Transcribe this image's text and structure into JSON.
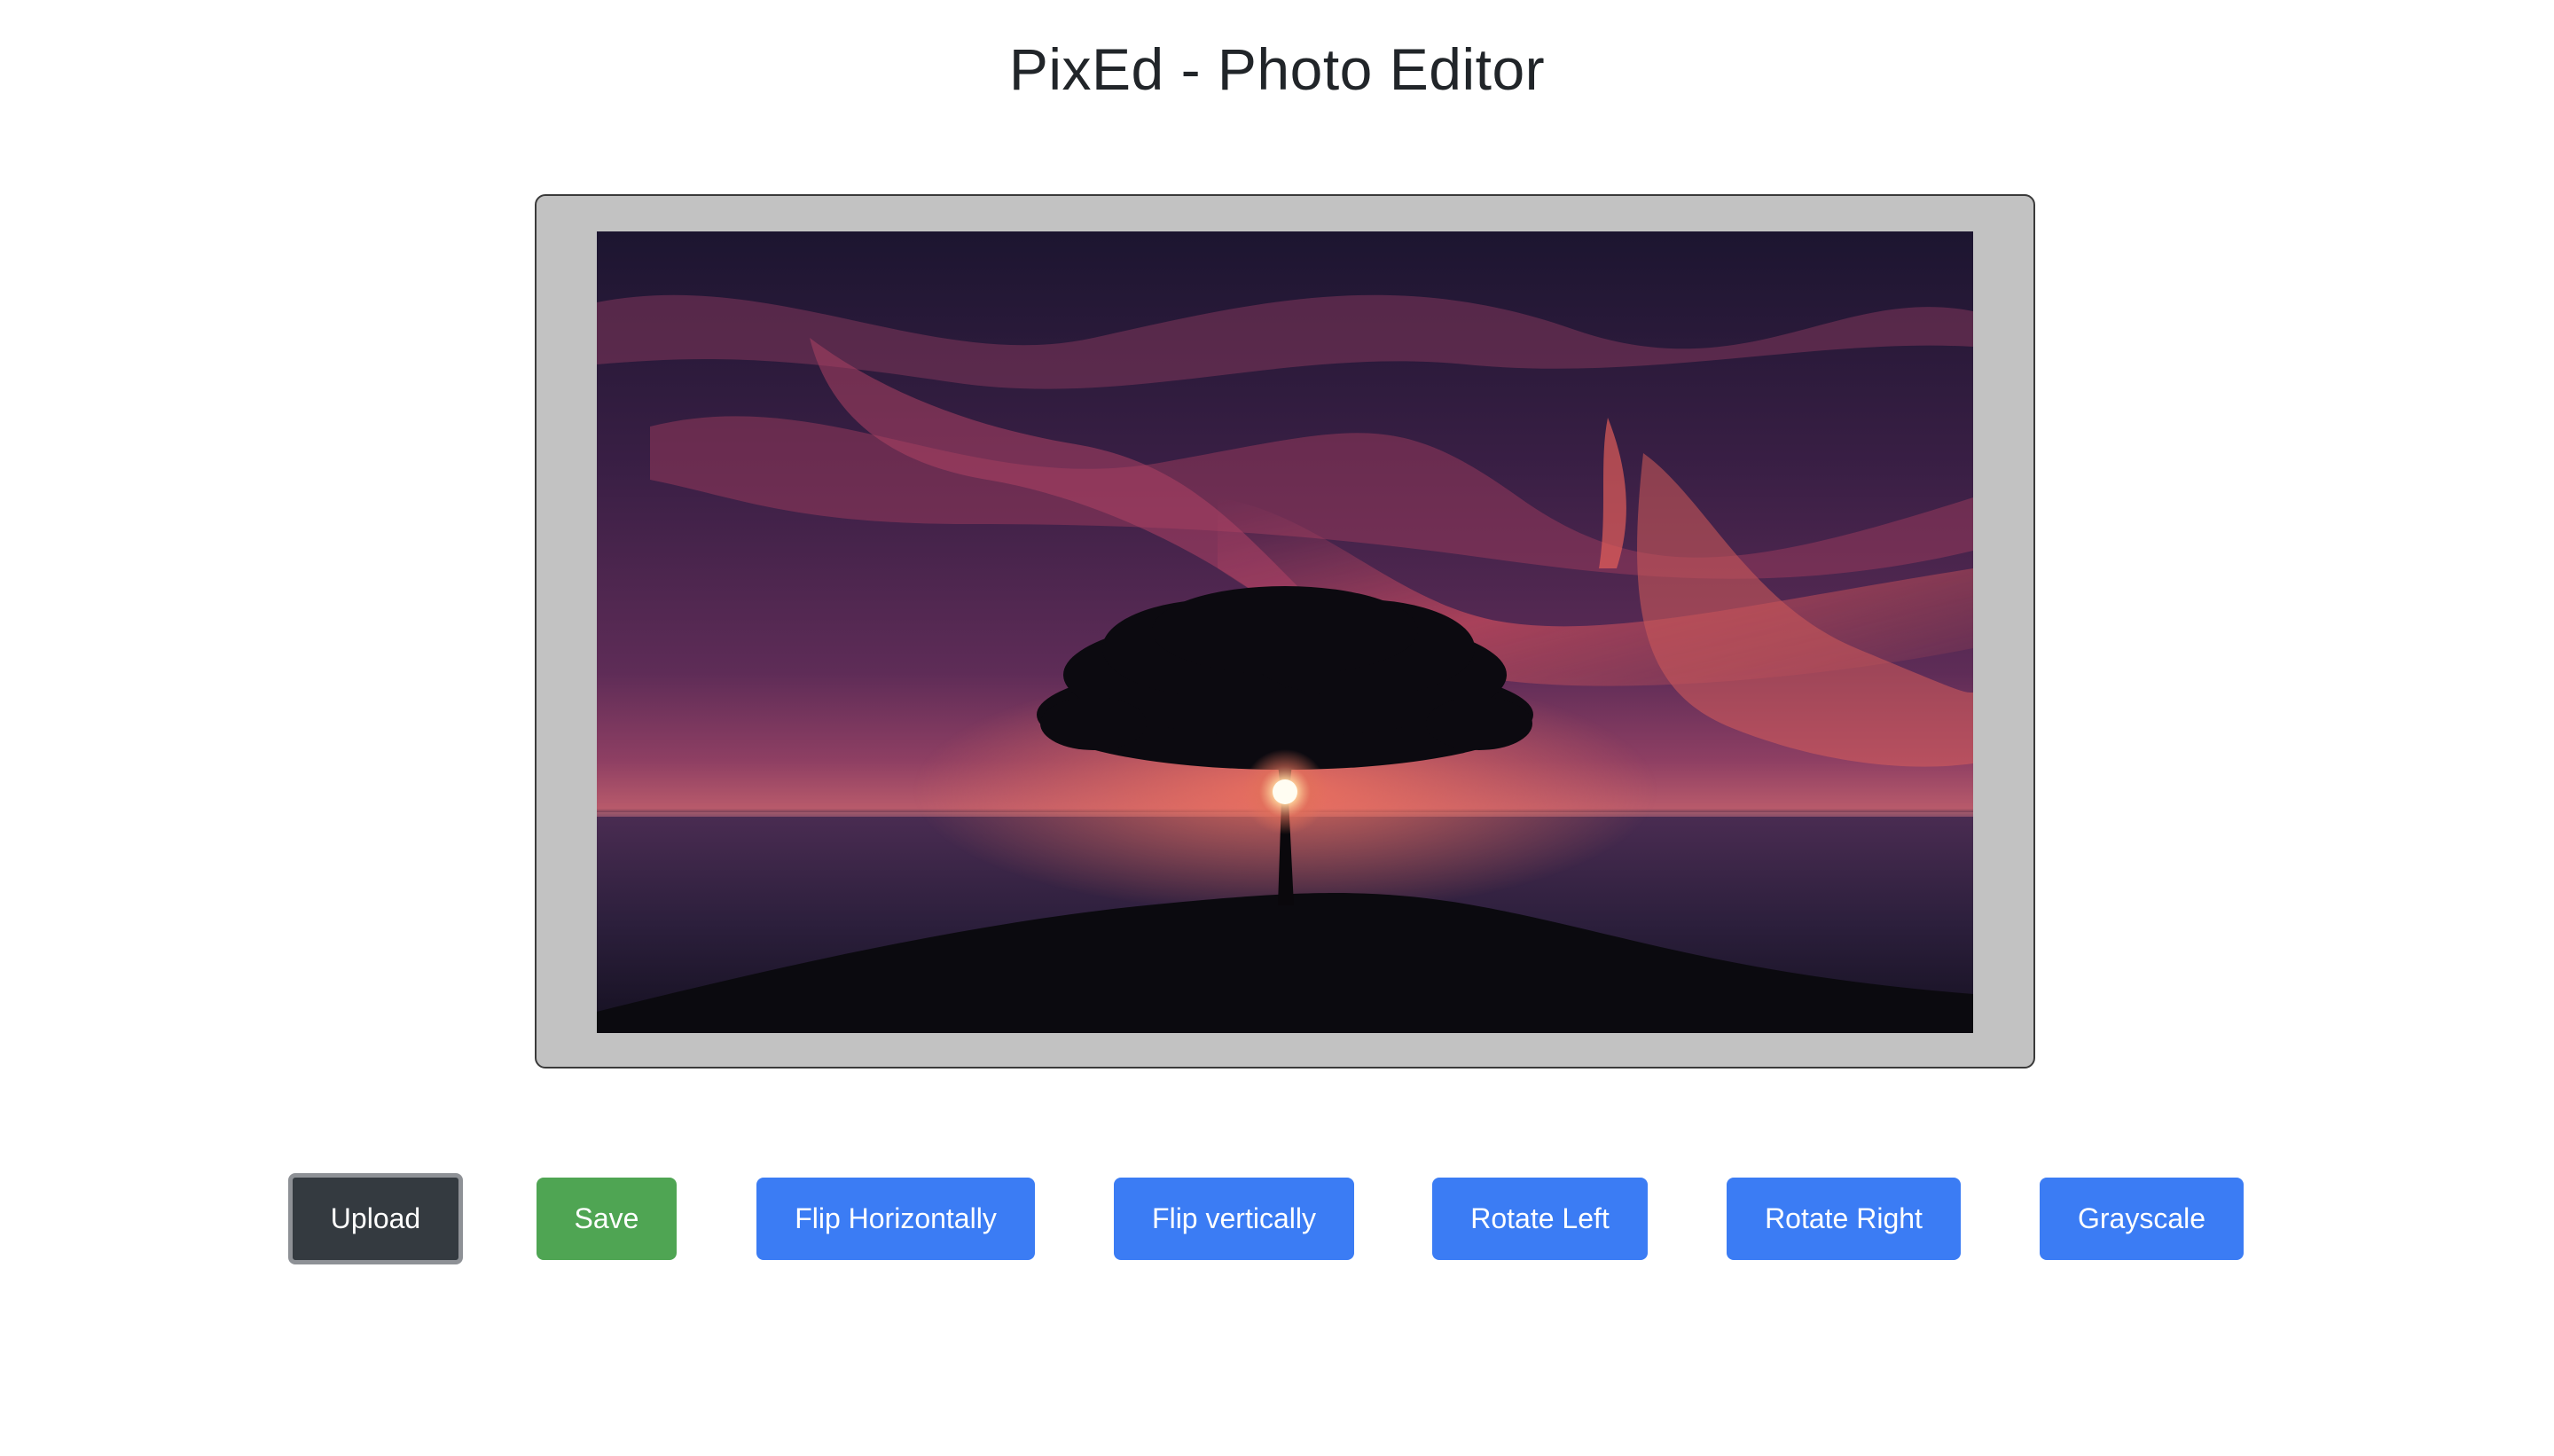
{
  "header": {
    "title": "PixEd - Photo Editor"
  },
  "canvas": {
    "image_subject": "silhouette of a tree on a hill at sunset over the sea under a purple and red cloudy sky"
  },
  "toolbar": {
    "upload_label": "Upload",
    "save_label": "Save",
    "flip_horizontal_label": "Flip Horizontally",
    "flip_vertical_label": "Flip vertically",
    "rotate_left_label": "Rotate Left",
    "rotate_right_label": "Rotate Right",
    "grayscale_label": "Grayscale"
  },
  "colors": {
    "upload_button": "#343a40",
    "save_button": "#4fa553",
    "action_button": "#3b7cf4",
    "canvas_frame": "#c2c2c2"
  }
}
